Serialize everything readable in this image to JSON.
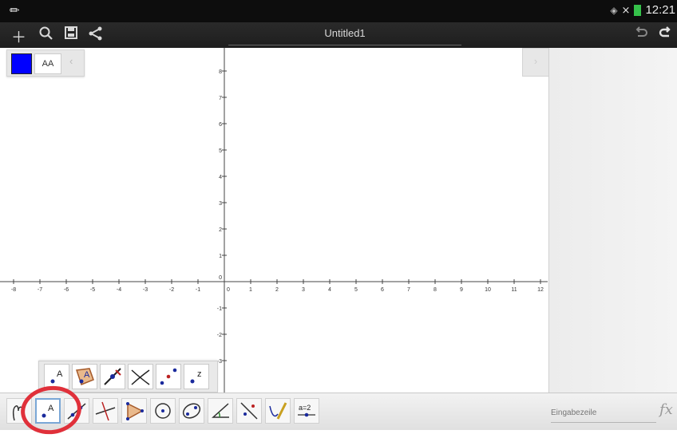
{
  "status_bar": {
    "time": "12:21"
  },
  "action_bar": {
    "title": "Untitled1"
  },
  "style_bar": {
    "label_style": "AA",
    "color": "#0000ff"
  },
  "axes": {
    "x_labels": [
      "-8",
      "-7",
      "-6",
      "-5",
      "-4",
      "-3",
      "-2",
      "-1",
      "0",
      "1",
      "2",
      "3",
      "4",
      "5",
      "6",
      "7",
      "8",
      "9",
      "10",
      "11",
      "12"
    ],
    "y_labels": [
      "8",
      "7",
      "6",
      "5",
      "4",
      "3",
      "2",
      "1",
      "-1",
      "-2",
      "-3"
    ]
  },
  "subtools": [
    {
      "name": "point-icon",
      "label": "A"
    },
    {
      "name": "point-on-object-icon",
      "label": "A"
    },
    {
      "name": "attach-detach-icon",
      "label": ""
    },
    {
      "name": "intersect-icon",
      "label": ""
    },
    {
      "name": "midpoint-icon",
      "label": ""
    },
    {
      "name": "complex-number-icon",
      "label": "z"
    }
  ],
  "toolbar": {
    "slider_label": "a=2",
    "input_placeholder": "Eingabezeile",
    "fx_label": "fx"
  }
}
